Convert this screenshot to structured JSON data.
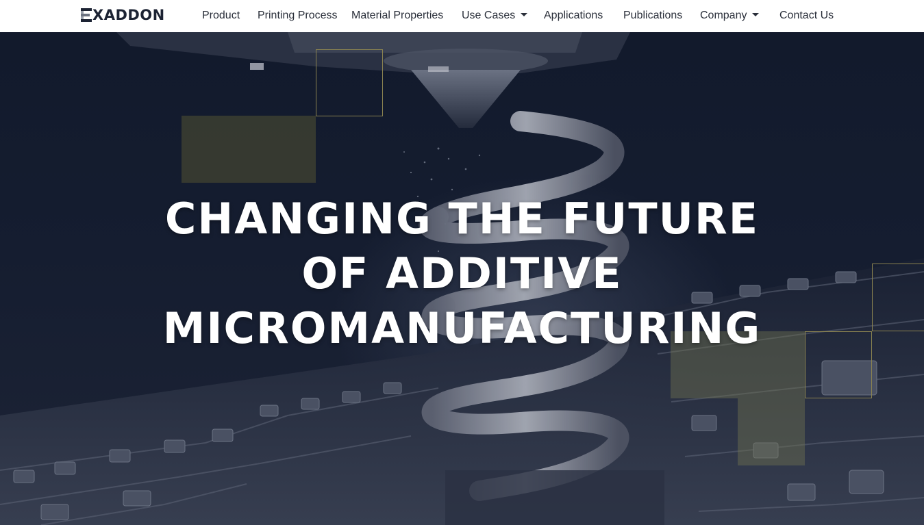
{
  "brand": {
    "name": "XADDON",
    "logo_name": "EXADDON"
  },
  "nav": {
    "items": [
      {
        "label": "Product",
        "dropdown": false
      },
      {
        "label": "Printing Process",
        "dropdown": false
      },
      {
        "label": "Material Properties",
        "dropdown": false
      },
      {
        "label": "Use Cases",
        "dropdown": true
      },
      {
        "label": "Applications",
        "dropdown": false
      },
      {
        "label": "Publications",
        "dropdown": false
      },
      {
        "label": "Company",
        "dropdown": true
      },
      {
        "label": "Contact Us",
        "dropdown": false
      }
    ]
  },
  "hero": {
    "headline_lines": [
      "CHANGING THE FUTURE",
      "OF ADDITIVE",
      "MICROMANUFACTURING"
    ],
    "colors": {
      "background": "#141b2d",
      "accent_outline": "#8c8450",
      "accent_fill": "#3c3e30"
    }
  }
}
